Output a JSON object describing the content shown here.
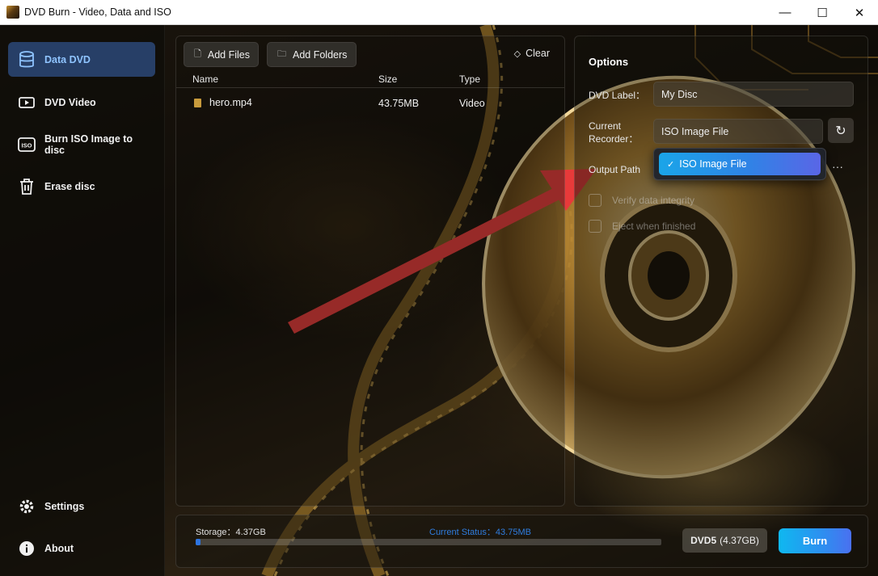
{
  "window": {
    "title": "DVD Burn - Video, Data and ISO",
    "controls": {
      "minimize": "—",
      "maximize": "☐",
      "close": "✕"
    }
  },
  "sidebar": {
    "items": [
      {
        "label": "Data DVD",
        "icon": "database-icon",
        "active": true
      },
      {
        "label": "DVD Video",
        "icon": "video-icon",
        "active": false
      },
      {
        "label": "Burn ISO Image to disc",
        "icon": "iso-icon",
        "active": false
      },
      {
        "label": "Erase disc",
        "icon": "trash-icon",
        "active": false
      }
    ],
    "bottom_items": [
      {
        "label": "Settings",
        "icon": "gear-icon"
      },
      {
        "label": "About",
        "icon": "info-icon"
      }
    ]
  },
  "files": {
    "add_files": "Add Files",
    "add_folders": "Add Folders",
    "clear": "Clear",
    "columns": {
      "name": "Name",
      "size": "Size",
      "type": "Type"
    },
    "rows": [
      {
        "name": "hero.mp4",
        "size": "43.75MB",
        "type": "Video"
      }
    ]
  },
  "options": {
    "title": "Options",
    "dvd_label": {
      "label": "DVD Label：",
      "value": "My Disc"
    },
    "recorder": {
      "label_line1": "Current",
      "label_line2": "Recorder：",
      "value": "ISO Image File"
    },
    "output_path": {
      "label": "Output Path",
      "value": ""
    },
    "checkboxes": [
      {
        "label": "Verify data integrity"
      },
      {
        "label": "Eject when finished"
      }
    ],
    "dropdown": {
      "options": [
        {
          "label": "ISO Image File",
          "selected": true
        }
      ]
    }
  },
  "status": {
    "storage": "Storage：4.37GB",
    "current": "Current Status：43.75MB",
    "progress_fraction": 0.01,
    "disc_type": "DVD5",
    "disc_capacity": "(4.37GB)",
    "burn": "Burn"
  },
  "colors": {
    "accent": "#2d74e0",
    "burn_gradient_start": "#0fb8f0",
    "burn_gradient_end": "#4a70f0",
    "arrow": "#e83a3a"
  }
}
